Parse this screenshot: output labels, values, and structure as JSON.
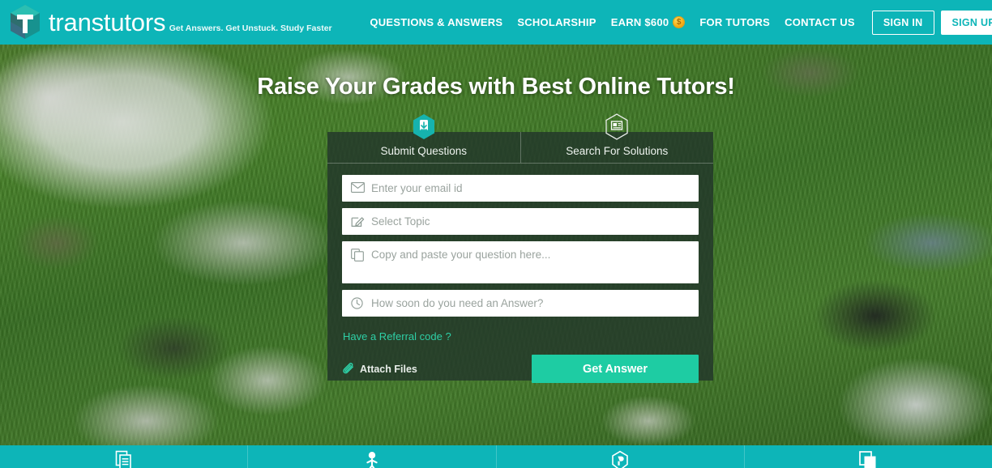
{
  "brand": {
    "name": "transtutors",
    "tagline": "Get Answers. Get Unstuck. Study Faster",
    "logo_icon": "hexagon-t-logo-icon"
  },
  "colors": {
    "teal": "#0db5b8",
    "accent_green": "#1ecca3",
    "referral_link": "#2ecfa6",
    "panel_overlay": "rgba(34,52,42,0.80)",
    "white": "#ffffff"
  },
  "nav": {
    "links": [
      {
        "label": "QUESTIONS & ANSWERS"
      },
      {
        "label": "SCHOLARSHIP"
      },
      {
        "label": "EARN $600",
        "icon": "coin-icon"
      },
      {
        "label": "FOR TUTORS"
      },
      {
        "label": "CONTACT US"
      }
    ],
    "sign_in_label": "SIGN IN",
    "sign_up_label": "SIGN UP"
  },
  "hero": {
    "title": "Raise Your Grades with Best Online Tutors!"
  },
  "form": {
    "tabs": [
      {
        "label": "Submit Questions",
        "icon": "hexagon-download-icon",
        "active": true
      },
      {
        "label": "Search For Solutions",
        "icon": "hexagon-news-icon",
        "active": false
      }
    ],
    "fields": [
      {
        "name": "email",
        "placeholder": "Enter your email id",
        "value": "",
        "icon": "envelope-icon"
      },
      {
        "name": "topic",
        "placeholder": "Select Topic",
        "value": "",
        "icon": "pencil-edit-icon"
      },
      {
        "name": "question",
        "placeholder": "Copy and paste your question here...",
        "value": "",
        "icon": "copy-icon"
      },
      {
        "name": "deadline",
        "placeholder": "How soon do you need an Answer?",
        "value": "",
        "icon": "clock-icon"
      }
    ],
    "referral_label": "Have a Referral code ?",
    "attach_label": "Attach Files",
    "attach_icon": "paperclip-icon",
    "submit_label": "Get Answer"
  },
  "bottom_bar": {
    "features": [
      {
        "icon": "stacked-documents-icon"
      },
      {
        "icon": "person-icon"
      },
      {
        "icon": "shield-p-icon"
      },
      {
        "icon": "copy-pages-icon"
      }
    ]
  }
}
